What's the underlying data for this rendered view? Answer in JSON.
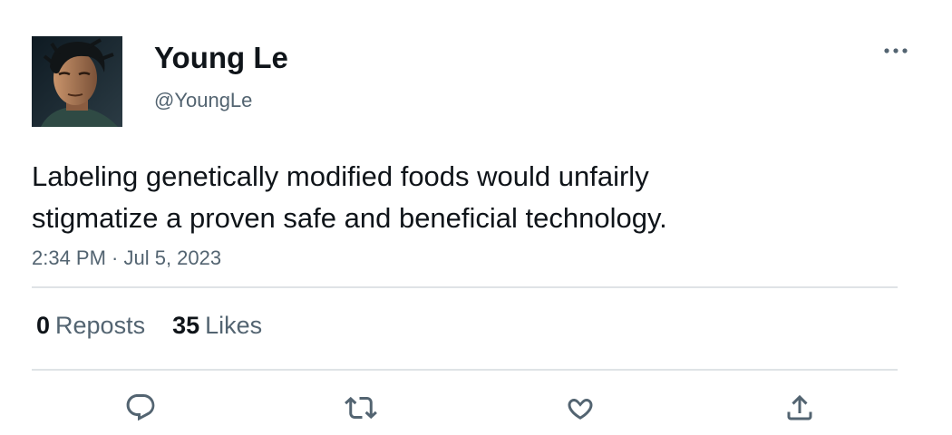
{
  "author": {
    "display_name": "Young Le",
    "handle": "@YoungLe",
    "avatar_icon": "profile-photo"
  },
  "tweet": {
    "text_line_1": "Labeling genetically modified foods would unfairly",
    "text_line_2": "stigmatize a proven safe and beneficial technology.",
    "timestamp": "2:34 PM · Jul 5, 2023"
  },
  "stats": {
    "reposts_count": "0",
    "reposts_label": "Reposts",
    "likes_count": "35",
    "likes_label": "Likes"
  },
  "actions": [
    {
      "icon": "reply-icon"
    },
    {
      "icon": "repost-icon"
    },
    {
      "icon": "like-icon"
    },
    {
      "icon": "share-icon"
    }
  ],
  "colors": {
    "text_primary": "#0f1419",
    "text_secondary": "#536471",
    "divider": "#dfe3e6",
    "icon": "#536471"
  }
}
